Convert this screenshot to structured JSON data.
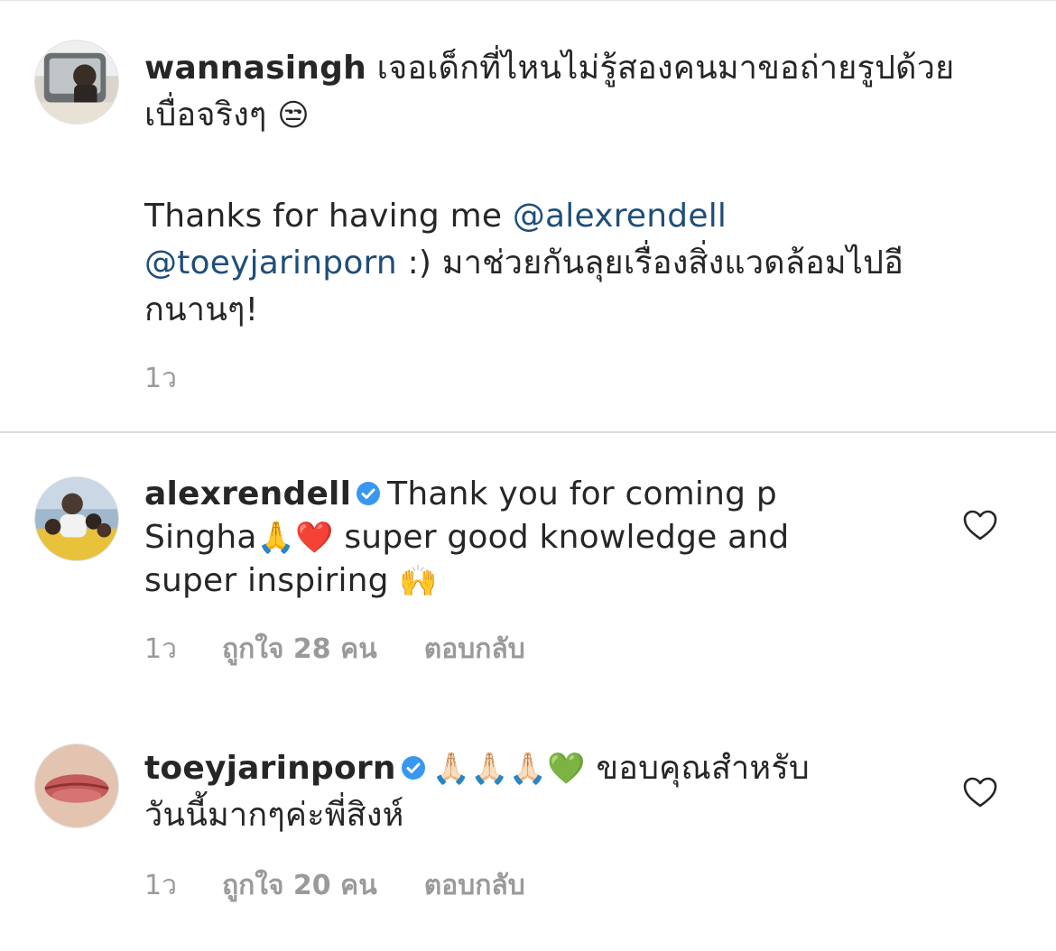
{
  "comments": [
    {
      "username": "wannasingh",
      "text_line1": "เจอเด็กที่ไหนไม่รู้สองคนมาขอถ่ายรูปด้วย",
      "text_line2_prefix": "เบื่อจริงๆ",
      "emoji1": "😒",
      "para2_part1": "Thanks for having me ",
      "mention1": "@alexrendell",
      "mention2": "@toeyjarinporn",
      "para2_part2": " :) มาช่วยกันลุยเรื่องสิ่งแวดล้อมไปอี",
      "para2_part3": "กนานๆ!",
      "time": "1ว"
    },
    {
      "username": "alexrendell",
      "verified": true,
      "line1": "Thank you for coming p",
      "line2_a": "Singha",
      "emoji_pray": "🙏",
      "emoji_heart": "❤️",
      "line2_b": " super good knowledge and",
      "line3": "super inspiring ",
      "emoji_raise": "🙌",
      "time": "1ว",
      "likes": "ถูกใจ 28 คน",
      "reply": "ตอบกลับ"
    },
    {
      "username": "toeyjarinporn",
      "verified": true,
      "emojis": "🙏🏻🙏🏻🙏🏻💚",
      "line1": " ขอบคุณสำหรับ",
      "line2": "วันนี้มากๆค่ะพี่สิงห์",
      "time": "1ว",
      "likes": "ถูกใจ 20 คน",
      "reply": "ตอบกลับ"
    }
  ],
  "colors": {
    "mention": "#1f4e79",
    "verified": "#3897f0",
    "meta": "#9a9a9a"
  },
  "icons": [
    "verified-badge-icon",
    "heart-outline-icon"
  ]
}
